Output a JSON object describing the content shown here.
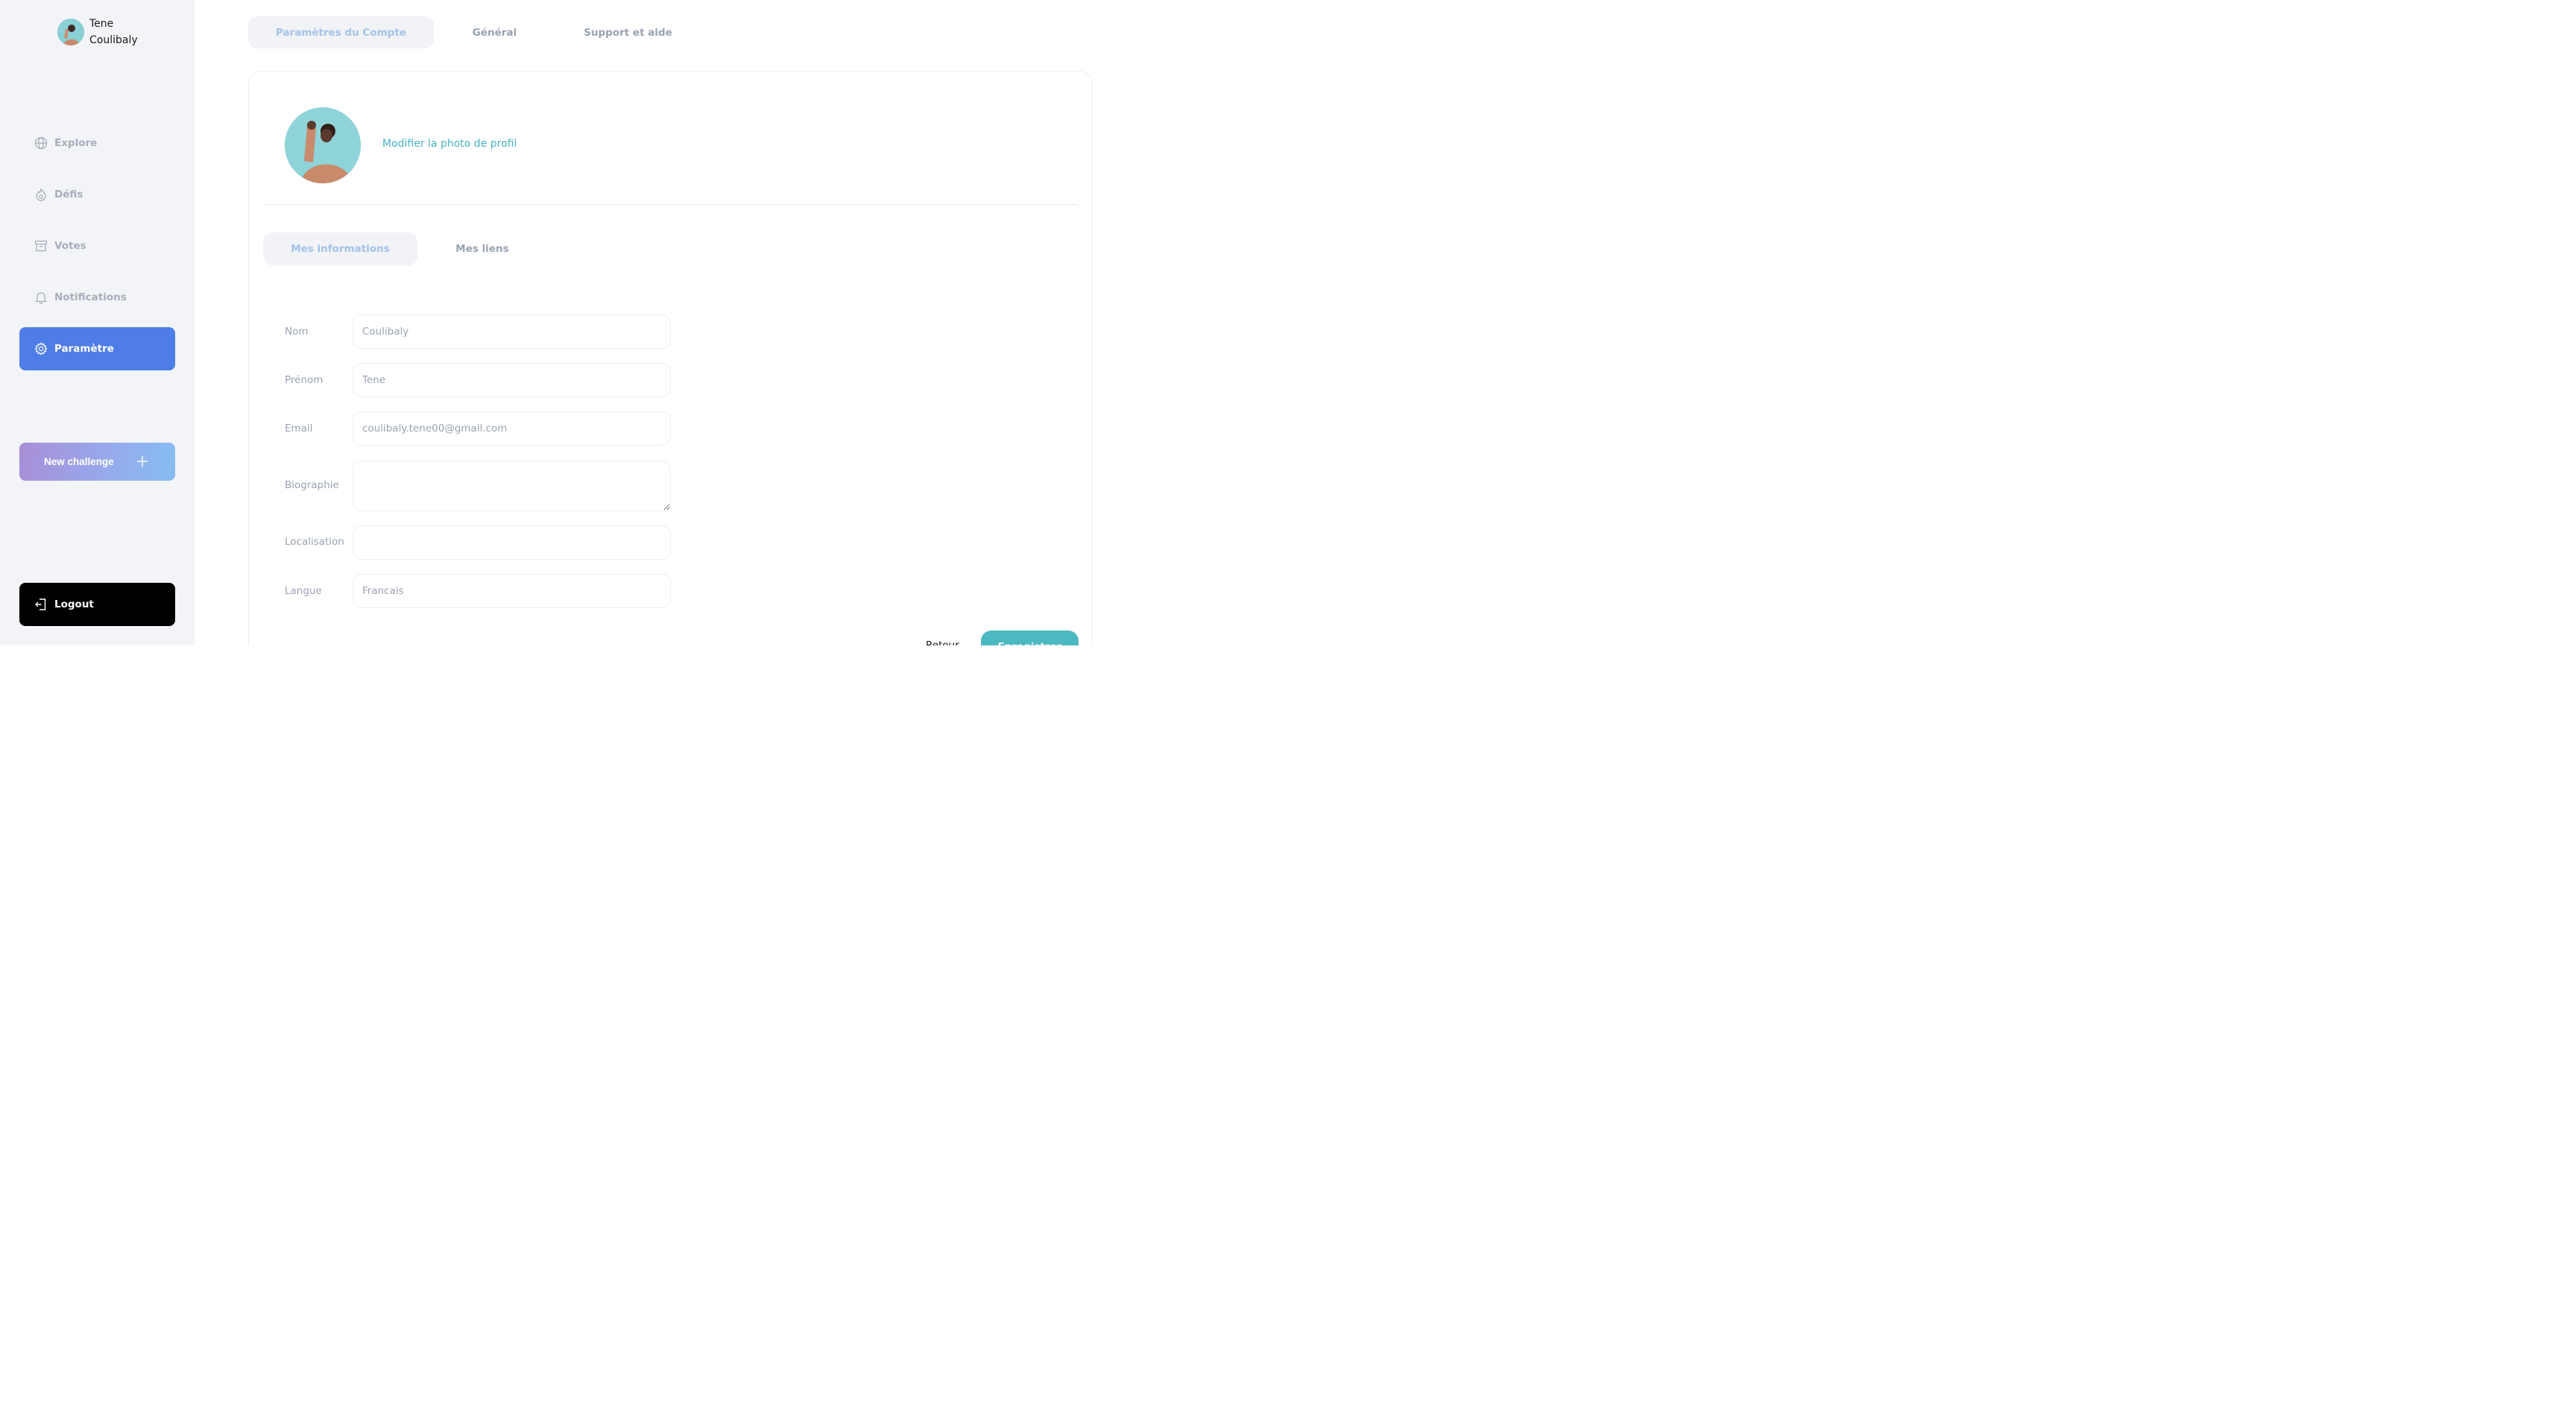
{
  "user": {
    "name": "Tene Coulibaly"
  },
  "sidebar": {
    "items": [
      {
        "label": "Explore",
        "icon": "globe-icon"
      },
      {
        "label": "Défis",
        "icon": "flame-icon"
      },
      {
        "label": "Votes",
        "icon": "archive-box-icon"
      },
      {
        "label": "Notifications",
        "icon": "bell-icon"
      },
      {
        "label": "Paramètre",
        "icon": "gear-icon",
        "active": true
      }
    ],
    "new_challenge_label": "New challenge",
    "logout_label": "Logout"
  },
  "top_tabs": [
    {
      "label": "Paramètres du Compte",
      "active": true
    },
    {
      "label": "Général"
    },
    {
      "label": "Support et aide"
    }
  ],
  "profile": {
    "change_photo_label": "Modifier la photo de profil"
  },
  "sub_tabs": [
    {
      "label": "Mes informations",
      "active": true
    },
    {
      "label": "Mes liens"
    }
  ],
  "form": {
    "nom": {
      "label": "Nom",
      "value": "Coulibaly"
    },
    "prenom": {
      "label": "Prénom",
      "value": "Tene"
    },
    "email": {
      "label": "Email",
      "value": "coulibaly.tene00@gmail.com"
    },
    "biographie": {
      "label": "Biographie",
      "value": ""
    },
    "localisation": {
      "label": "Localisation",
      "value": ""
    },
    "langue": {
      "label": "Langue",
      "value": "Francais"
    }
  },
  "actions": {
    "back_label": "Retour",
    "save_label": "Enregistrer"
  },
  "colors": {
    "accent": "#4f7de8",
    "teal": "#4cb8bf",
    "sidebar_bg": "#f3f4f7",
    "muted_text": "#9aa3b2"
  }
}
